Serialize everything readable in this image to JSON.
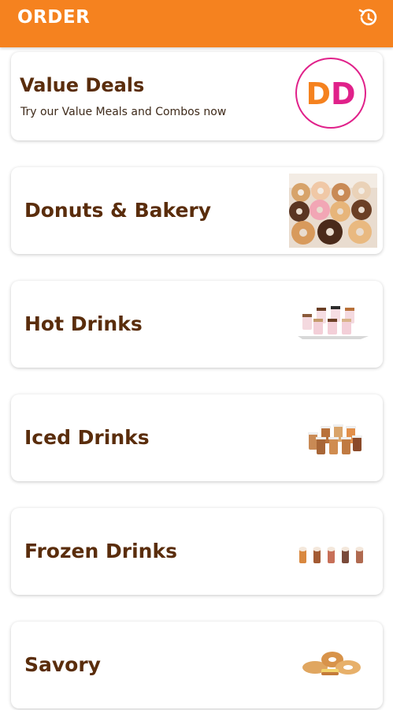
{
  "header": {
    "title": "ORDER",
    "history_icon": "history-icon"
  },
  "colors": {
    "brand_orange": "#f5821f",
    "brand_pink": "#e0218a",
    "title_brown": "#5a2d0c"
  },
  "value_deals": {
    "title": "Value Deals",
    "subtitle": "Try our Value Meals and Combos now",
    "logo_letters": [
      "D",
      "D"
    ]
  },
  "categories": [
    {
      "title": "Donuts & Bakery",
      "image": "donuts-photo"
    },
    {
      "title": "Hot Drinks",
      "image": "hot-drinks-photo"
    },
    {
      "title": "Iced Drinks",
      "image": "iced-drinks-photo"
    },
    {
      "title": "Frozen Drinks",
      "image": "frozen-drinks-photo"
    },
    {
      "title": "Savory",
      "image": "savory-photo"
    }
  ]
}
